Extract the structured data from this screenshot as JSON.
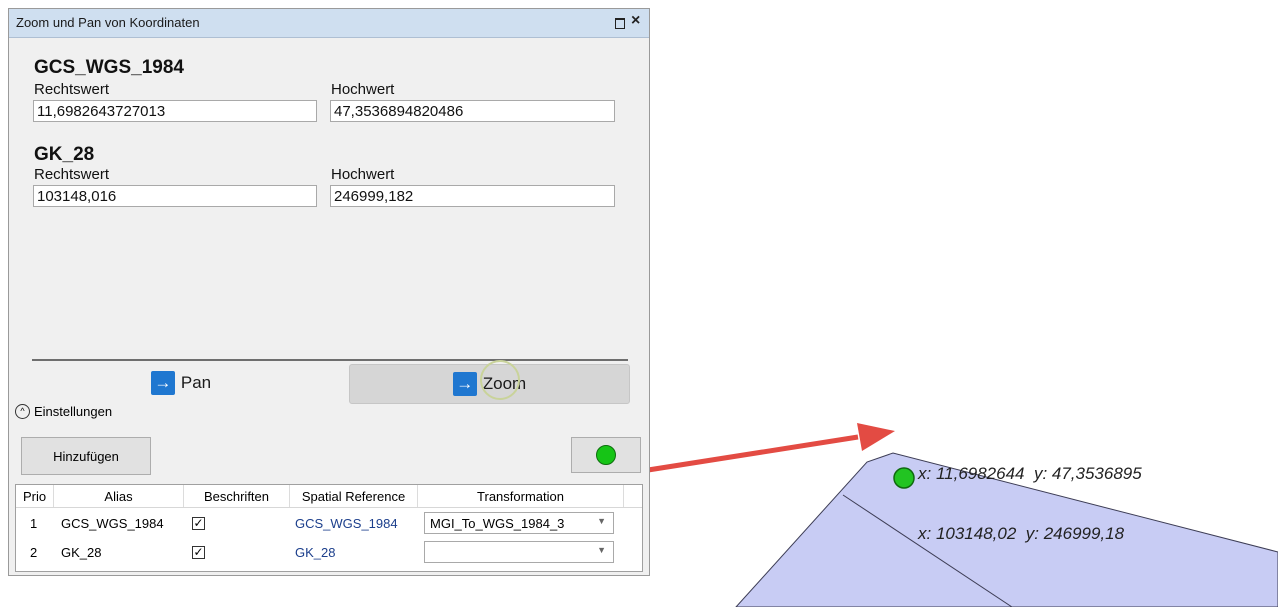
{
  "dialog": {
    "title": "Zoom und Pan von Koordinaten",
    "restore_icon": "restore-icon",
    "close_icon": "×"
  },
  "systems": [
    {
      "name": "GCS_WGS_1984",
      "east_label": "Rechtswert",
      "east_value": "11,6982643727013",
      "north_label": "Hochwert",
      "north_value": "47,3536894820486"
    },
    {
      "name": "GK_28",
      "east_label": "Rechtswert",
      "east_value": "103148,016",
      "north_label": "Hochwert",
      "north_value": "246999,182"
    }
  ],
  "actions": {
    "pan_label": "Pan",
    "zoom_label": "Zoom",
    "arrow_glyph": "→"
  },
  "settings": {
    "toggle_label": "Einstellungen",
    "toggle_glyph": "^",
    "add_label": "Hinzufügen",
    "status_color": "#16c416"
  },
  "grid": {
    "headers": [
      "Prio",
      "Alias",
      "Beschriften",
      "Spatial Reference",
      "Transformation"
    ],
    "rows": [
      {
        "prio": "1",
        "alias": "GCS_WGS_1984",
        "label_checked": "✓",
        "spatial_reference": "GCS_WGS_1984",
        "transformation": "MGI_To_WGS_1984_3"
      },
      {
        "prio": "2",
        "alias": "GK_28",
        "label_checked": "✓",
        "spatial_reference": "GK_28",
        "transformation": ""
      }
    ]
  },
  "map": {
    "label_line1": "x: 11,6982644  y: 47,3536895",
    "label_line2": "x: 103148,02  y: 246999,18",
    "polygon_color": "#c8ccf4",
    "point_color": "#22c422",
    "arrow_color": "#e34b43"
  }
}
